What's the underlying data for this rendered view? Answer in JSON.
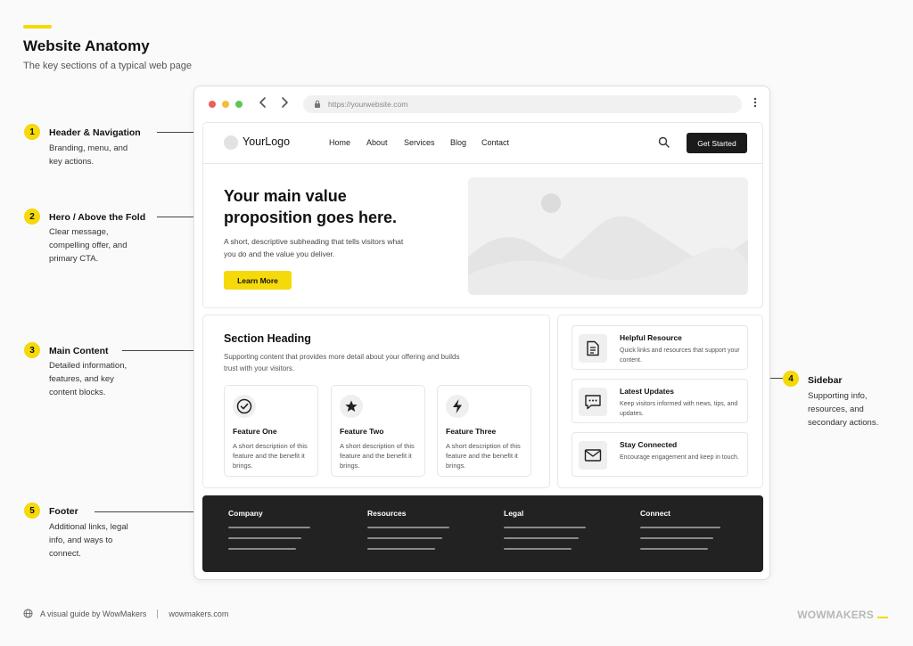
{
  "header": {
    "title": "Website Anatomy",
    "subtitle": "The key sections of a typical web page",
    "accent_color": "#f5d90a"
  },
  "annotations": [
    {
      "number": "1",
      "title": "Header & Navigation",
      "desc": "Branding, menu, and key actions."
    },
    {
      "number": "2",
      "title": "Hero / Above the Fold",
      "desc": "Clear message, compelling offer, and primary CTA."
    },
    {
      "number": "3",
      "title": "Main Content",
      "desc": "Detailed information, features, and key content blocks."
    },
    {
      "number": "4",
      "title": "Sidebar",
      "desc": "Supporting info, resources, and secondary actions."
    },
    {
      "number": "5",
      "title": "Footer",
      "desc": "Additional links, legal info, and ways to connect."
    }
  ],
  "browser": {
    "url": "https://yourwebsite.com"
  },
  "site": {
    "logo": "YourLogo",
    "nav": [
      "Home",
      "About",
      "Services",
      "Blog",
      "Contact"
    ],
    "cta": "Get Started"
  },
  "hero": {
    "title": "Your main value proposition goes here.",
    "subtitle": "A short, descriptive subheading that tells visitors what you do and the value you deliver.",
    "button": "Learn More"
  },
  "main": {
    "heading": "Section Heading",
    "subheading": "Supporting content that provides more detail about your offering and builds trust with your visitors.",
    "features": [
      {
        "title": "Feature One",
        "desc": "A short description of this feature and the benefit it brings.",
        "icon": "check-circle-icon"
      },
      {
        "title": "Feature Two",
        "desc": "A short description of this feature and the benefit it brings.",
        "icon": "star-icon"
      },
      {
        "title": "Feature Three",
        "desc": "A short description of this feature and the benefit it brings.",
        "icon": "lightning-icon"
      }
    ]
  },
  "sidebar": {
    "items": [
      {
        "title": "Helpful Resource",
        "desc": "Quick links and resources that support your content.",
        "icon": "document-icon"
      },
      {
        "title": "Latest Updates",
        "desc": "Keep visitors informed with news, tips, and updates.",
        "icon": "chat-icon"
      },
      {
        "title": "Stay Connected",
        "desc": "Encourage engagement and keep in touch.",
        "icon": "mail-icon"
      }
    ]
  },
  "footer": {
    "columns": [
      "Company",
      "Resources",
      "Legal",
      "Connect"
    ]
  },
  "page_footer": {
    "credit": "A visual guide by WowMakers",
    "site": "wowmakers.com",
    "brand": "WOWMAKERS"
  }
}
